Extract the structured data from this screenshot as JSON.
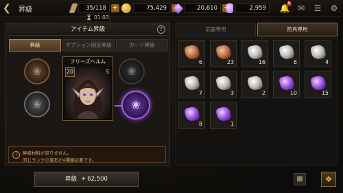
{
  "header": {
    "title": "昇級",
    "back_icon": "back-arrow-icon",
    "resources": [
      {
        "icon": "stamina-icon",
        "value": "35/118",
        "color": "#b89a62"
      },
      {
        "icon": "gold-coin-icon",
        "value": "75,429",
        "color": "#d7a43a"
      },
      {
        "icon": "gem-icon",
        "value": "20,610",
        "color": "#a75ce6"
      },
      {
        "icon": "crystal-icon",
        "value": "2,959",
        "color": "#c97cf0"
      }
    ],
    "timer": "01:03",
    "notification_badge": "N"
  },
  "left_panel": {
    "title": "アイテム昇級",
    "tabs": [
      "昇級",
      "オプション固定昇級",
      "カード昇級"
    ],
    "active_tab": 0,
    "hero": {
      "name": "フリーズヘルム",
      "level": "20",
      "grade": "S"
    },
    "notice": {
      "line1": "昇級材料が足りません。",
      "line2": "同じランクの宝石が4種類必要です。"
    },
    "upgrade_button": {
      "label": "昇級",
      "cost": "62,500"
    }
  },
  "right_panel": {
    "tabs": [
      "武器専用",
      "防具専用"
    ],
    "active_tab": 1,
    "items": [
      {
        "tier": "bronze",
        "qty": "6"
      },
      {
        "tier": "bronze",
        "qty": "23"
      },
      {
        "tier": "silver",
        "qty": "16"
      },
      {
        "tier": "silver",
        "qty": "6"
      },
      {
        "tier": "silver",
        "qty": "4"
      },
      {
        "tier": "silver",
        "qty": "7"
      },
      {
        "tier": "silver",
        "qty": "3"
      },
      {
        "tier": "silver",
        "qty": "2"
      },
      {
        "tier": "purple",
        "qty": "10"
      },
      {
        "tier": "purple",
        "qty": "15"
      },
      {
        "tier": "purple",
        "qty": "8"
      },
      {
        "tier": "purple",
        "qty": "1"
      }
    ]
  },
  "colors": {
    "accent": "#a35ee0",
    "gold": "#a88553"
  }
}
